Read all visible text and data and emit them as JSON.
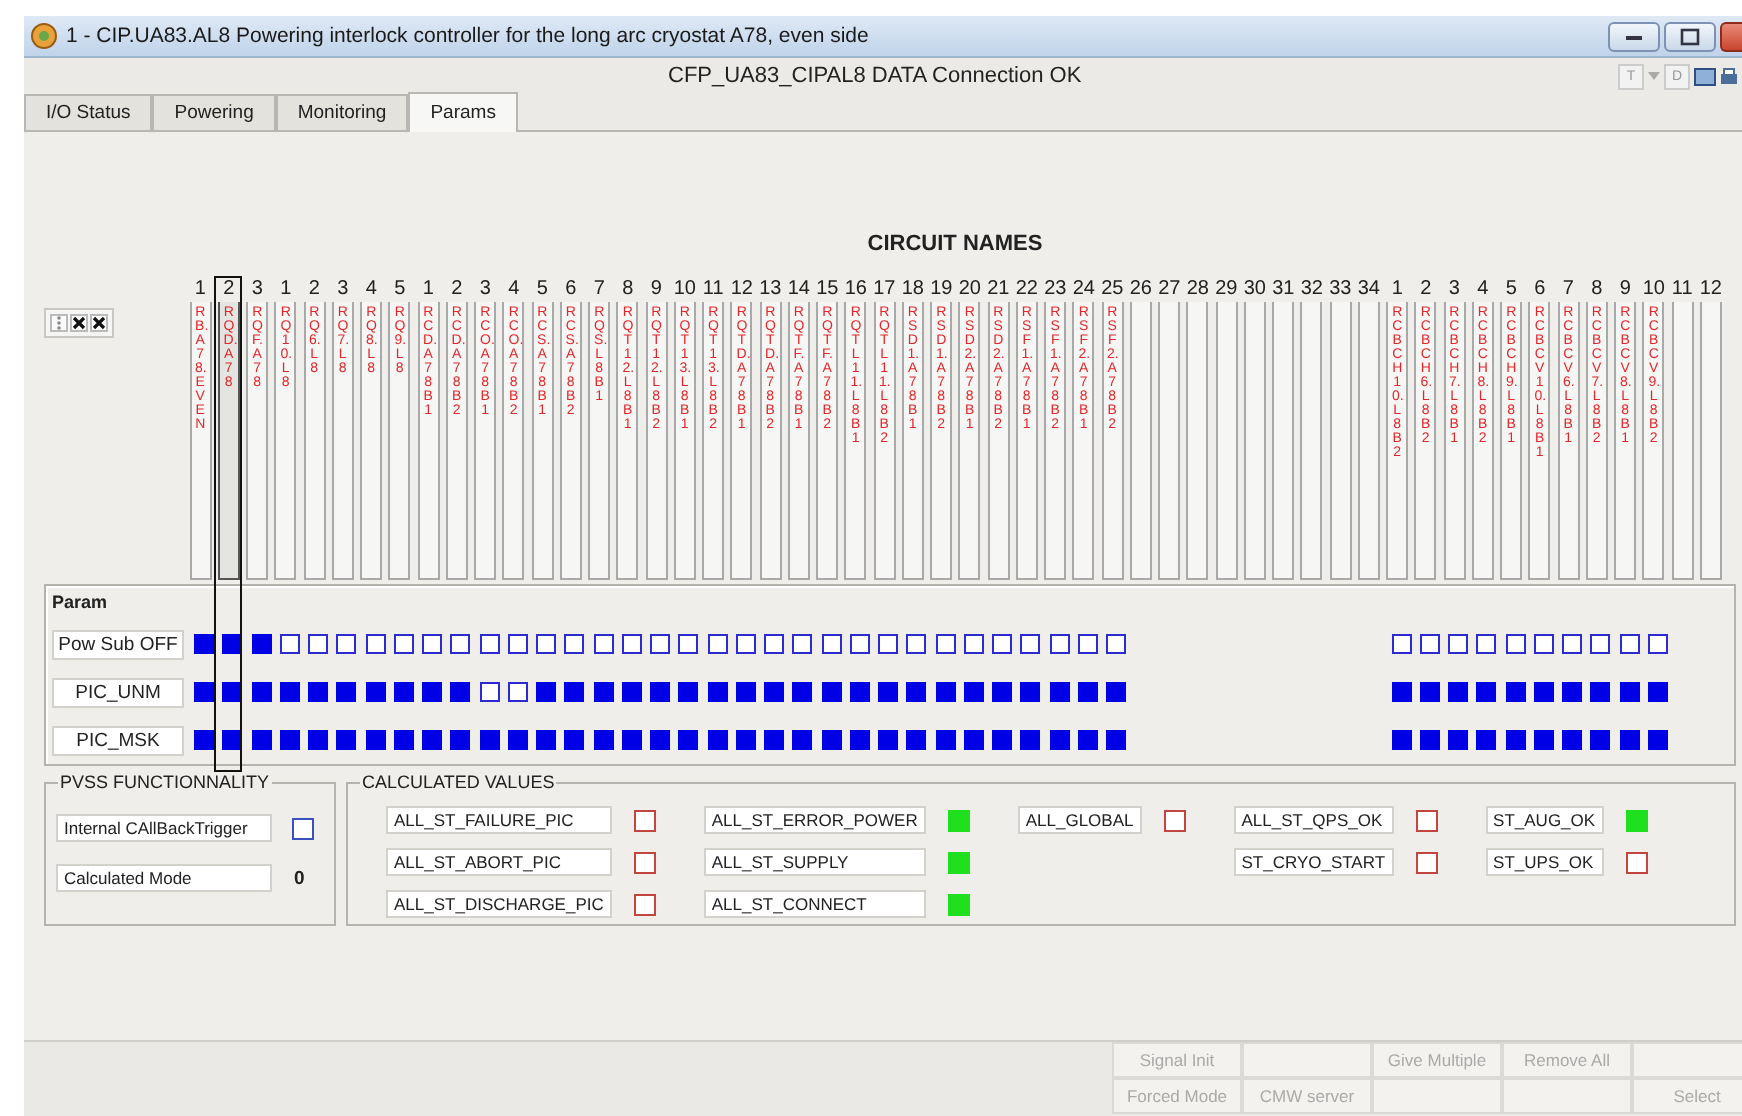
{
  "window": {
    "title": "1 - CIP.UA83.AL8 Powering interlock controller for the long arc cryostat A78, even side"
  },
  "connection_status": "CFP_UA83_CIPAL8 DATA Connection OK",
  "toolbar": [
    {
      "label": "T"
    },
    {
      "label": "D"
    }
  ],
  "tabs": [
    {
      "label": "I/O Status",
      "selected": false
    },
    {
      "label": "Powering",
      "selected": false
    },
    {
      "label": "Monitoring",
      "selected": false
    },
    {
      "label": "Params",
      "selected": true
    }
  ],
  "circuit_names": {
    "title": "CIRCUIT NAMES",
    "columns": [
      {
        "number": "1",
        "name": "RB.A78.EVEN",
        "selected": false,
        "params": [
          true,
          true,
          true
        ]
      },
      {
        "number": "2",
        "name": "RQD.A78",
        "selected": true,
        "params": [
          true,
          true,
          true
        ]
      },
      {
        "number": "3",
        "name": "RQF.A78",
        "selected": false,
        "params": [
          true,
          true,
          true
        ]
      },
      {
        "number": "1",
        "name": "RQ10.L8",
        "selected": false,
        "params": [
          false,
          true,
          true
        ]
      },
      {
        "number": "2",
        "name": "RQ6.L8",
        "selected": false,
        "params": [
          false,
          true,
          true
        ]
      },
      {
        "number": "3",
        "name": "RQ7.L8",
        "selected": false,
        "params": [
          false,
          true,
          true
        ]
      },
      {
        "number": "4",
        "name": "RQ8.L8",
        "selected": false,
        "params": [
          false,
          true,
          true
        ]
      },
      {
        "number": "5",
        "name": "RQ9.L8",
        "selected": false,
        "params": [
          false,
          true,
          true
        ]
      },
      {
        "number": "1",
        "name": "RCD.A78B1",
        "selected": false,
        "params": [
          false,
          true,
          true
        ]
      },
      {
        "number": "2",
        "name": "RCD.A78B2",
        "selected": false,
        "params": [
          false,
          true,
          true
        ]
      },
      {
        "number": "3",
        "name": "RCO.A78B1",
        "selected": false,
        "params": [
          false,
          false,
          true
        ]
      },
      {
        "number": "4",
        "name": "RCO.A78B2",
        "selected": false,
        "params": [
          false,
          false,
          true
        ]
      },
      {
        "number": "5",
        "name": "RCS.A78B1",
        "selected": false,
        "params": [
          false,
          true,
          true
        ]
      },
      {
        "number": "6",
        "name": "RCS.A78B2",
        "selected": false,
        "params": [
          false,
          true,
          true
        ]
      },
      {
        "number": "7",
        "name": "RQS.L8B1",
        "selected": false,
        "params": [
          false,
          true,
          true
        ]
      },
      {
        "number": "8",
        "name": "RQT12.L8B1",
        "selected": false,
        "params": [
          false,
          true,
          true
        ]
      },
      {
        "number": "9",
        "name": "RQT12.L8B2",
        "selected": false,
        "params": [
          false,
          true,
          true
        ]
      },
      {
        "number": "10",
        "name": "RQT13.L8B1",
        "selected": false,
        "params": [
          false,
          true,
          true
        ]
      },
      {
        "number": "11",
        "name": "RQT13.L8B2",
        "selected": false,
        "params": [
          false,
          true,
          true
        ]
      },
      {
        "number": "12",
        "name": "RQTD.A78B1",
        "selected": false,
        "params": [
          false,
          true,
          true
        ]
      },
      {
        "number": "13",
        "name": "RQTD.A78B2",
        "selected": false,
        "params": [
          false,
          true,
          true
        ]
      },
      {
        "number": "14",
        "name": "RQTF.A78B1",
        "selected": false,
        "params": [
          false,
          true,
          true
        ]
      },
      {
        "number": "15",
        "name": "RQTF.A78B2",
        "selected": false,
        "params": [
          false,
          true,
          true
        ]
      },
      {
        "number": "16",
        "name": "RQTL11.L8B1",
        "selected": false,
        "params": [
          false,
          true,
          true
        ]
      },
      {
        "number": "17",
        "name": "RQTL11.L8B2",
        "selected": false,
        "params": [
          false,
          true,
          true
        ]
      },
      {
        "number": "18",
        "name": "RSD1.A78B1",
        "selected": false,
        "params": [
          false,
          true,
          true
        ]
      },
      {
        "number": "19",
        "name": "RSD1.A78B2",
        "selected": false,
        "params": [
          false,
          true,
          true
        ]
      },
      {
        "number": "20",
        "name": "RSD2.A78B1",
        "selected": false,
        "params": [
          false,
          true,
          true
        ]
      },
      {
        "number": "21",
        "name": "RSD2.A78B2",
        "selected": false,
        "params": [
          false,
          true,
          true
        ]
      },
      {
        "number": "22",
        "name": "RSF1.A78B1",
        "selected": false,
        "params": [
          false,
          true,
          true
        ]
      },
      {
        "number": "23",
        "name": "RSF1.A78B2",
        "selected": false,
        "params": [
          false,
          true,
          true
        ]
      },
      {
        "number": "24",
        "name": "RSF2.A78B1",
        "selected": false,
        "params": [
          false,
          true,
          true
        ]
      },
      {
        "number": "25",
        "name": "RSF2.A78B2",
        "selected": false,
        "params": [
          false,
          true,
          true
        ]
      },
      {
        "number": "26",
        "selected": false
      },
      {
        "number": "27",
        "selected": false
      },
      {
        "number": "28",
        "selected": false
      },
      {
        "number": "29",
        "selected": false
      },
      {
        "number": "30",
        "selected": false
      },
      {
        "number": "31",
        "selected": false
      },
      {
        "number": "32",
        "selected": false
      },
      {
        "number": "33",
        "selected": false
      },
      {
        "number": "34",
        "selected": false
      },
      {
        "number": "1",
        "name": "RCBCH10.L8B2",
        "selected": false,
        "params": [
          false,
          true,
          true
        ]
      },
      {
        "number": "2",
        "name": "RCBCH6.L8B2",
        "selected": false,
        "params": [
          false,
          true,
          true
        ]
      },
      {
        "number": "3",
        "name": "RCBCH7.L8B1",
        "selected": false,
        "params": [
          false,
          true,
          true
        ]
      },
      {
        "number": "4",
        "name": "RCBCH8.L8B2",
        "selected": false,
        "params": [
          false,
          true,
          true
        ]
      },
      {
        "number": "5",
        "name": "RCBCH9.L8B1",
        "selected": false,
        "params": [
          false,
          true,
          true
        ]
      },
      {
        "number": "6",
        "name": "RCBCV10.L8B1",
        "selected": false,
        "params": [
          false,
          true,
          true
        ]
      },
      {
        "number": "7",
        "name": "RCBCV6.L8B1",
        "selected": false,
        "params": [
          false,
          true,
          true
        ]
      },
      {
        "number": "8",
        "name": "RCBCV7.L8B2",
        "selected": false,
        "params": [
          false,
          true,
          true
        ]
      },
      {
        "number": "9",
        "name": "RCBCV8.L8B1",
        "selected": false,
        "params": [
          false,
          true,
          true
        ]
      },
      {
        "number": "10",
        "name": "RCBCV9.L8B2",
        "selected": false,
        "params": [
          false,
          true,
          true
        ]
      },
      {
        "number": "11",
        "selected": false
      },
      {
        "number": "12",
        "selected": false
      }
    ]
  },
  "param": {
    "title": "Param",
    "rows": [
      {
        "label": "Pow Sub OFF"
      },
      {
        "label": "PIC_UNM"
      },
      {
        "label": "PIC_MSK"
      }
    ]
  },
  "pvss": {
    "title": "PVSS FUNCTIONNALITY",
    "trigger": {
      "label": "Internal CAllBackTrigger",
      "on": false
    },
    "mode": {
      "label": "Calculated Mode",
      "value": "0"
    }
  },
  "calculated_values": {
    "title": "CALCULATED VALUES",
    "columns": [
      {
        "items": [
          {
            "label": "ALL_ST_FAILURE_PIC",
            "on": false
          },
          {
            "label": "ALL_ST_ABORT_PIC",
            "on": false
          },
          {
            "label": "ALL_ST_DISCHARGE_PIC",
            "on": false
          }
        ]
      },
      {
        "items": [
          {
            "label": "ALL_ST_ERROR_POWER",
            "on": true
          },
          {
            "label": "ALL_ST_SUPPLY",
            "on": true
          },
          {
            "label": "ALL_ST_CONNECT",
            "on": true
          }
        ]
      },
      {
        "items": [
          {
            "label": "ALL_GLOBAL",
            "on": false
          }
        ]
      },
      {
        "items": [
          {
            "label": "ALL_ST_QPS_OK",
            "on": false
          },
          {
            "label": "ST_CRYO_START",
            "on": false
          }
        ]
      },
      {
        "items": [
          {
            "label": "ST_AUG_OK",
            "on": true
          },
          {
            "label": "ST_UPS_OK",
            "on": false
          }
        ]
      }
    ]
  },
  "buttons": [
    {
      "kind": "text",
      "label": "Signal Init",
      "disabled": true
    },
    {
      "kind": "blank"
    },
    {
      "kind": "text",
      "label": "Give Multiple",
      "disabled": true
    },
    {
      "kind": "text",
      "label": "Remove All",
      "disabled": true
    },
    {
      "kind": "blank"
    },
    {
      "kind": "text",
      "label": "Forced Mode",
      "disabled": true
    },
    {
      "kind": "text",
      "label": "CMW server",
      "disabled": true
    },
    {
      "kind": "blank"
    },
    {
      "kind": "blank"
    },
    {
      "kind": "text",
      "label": "Select",
      "disabled": true
    }
  ]
}
